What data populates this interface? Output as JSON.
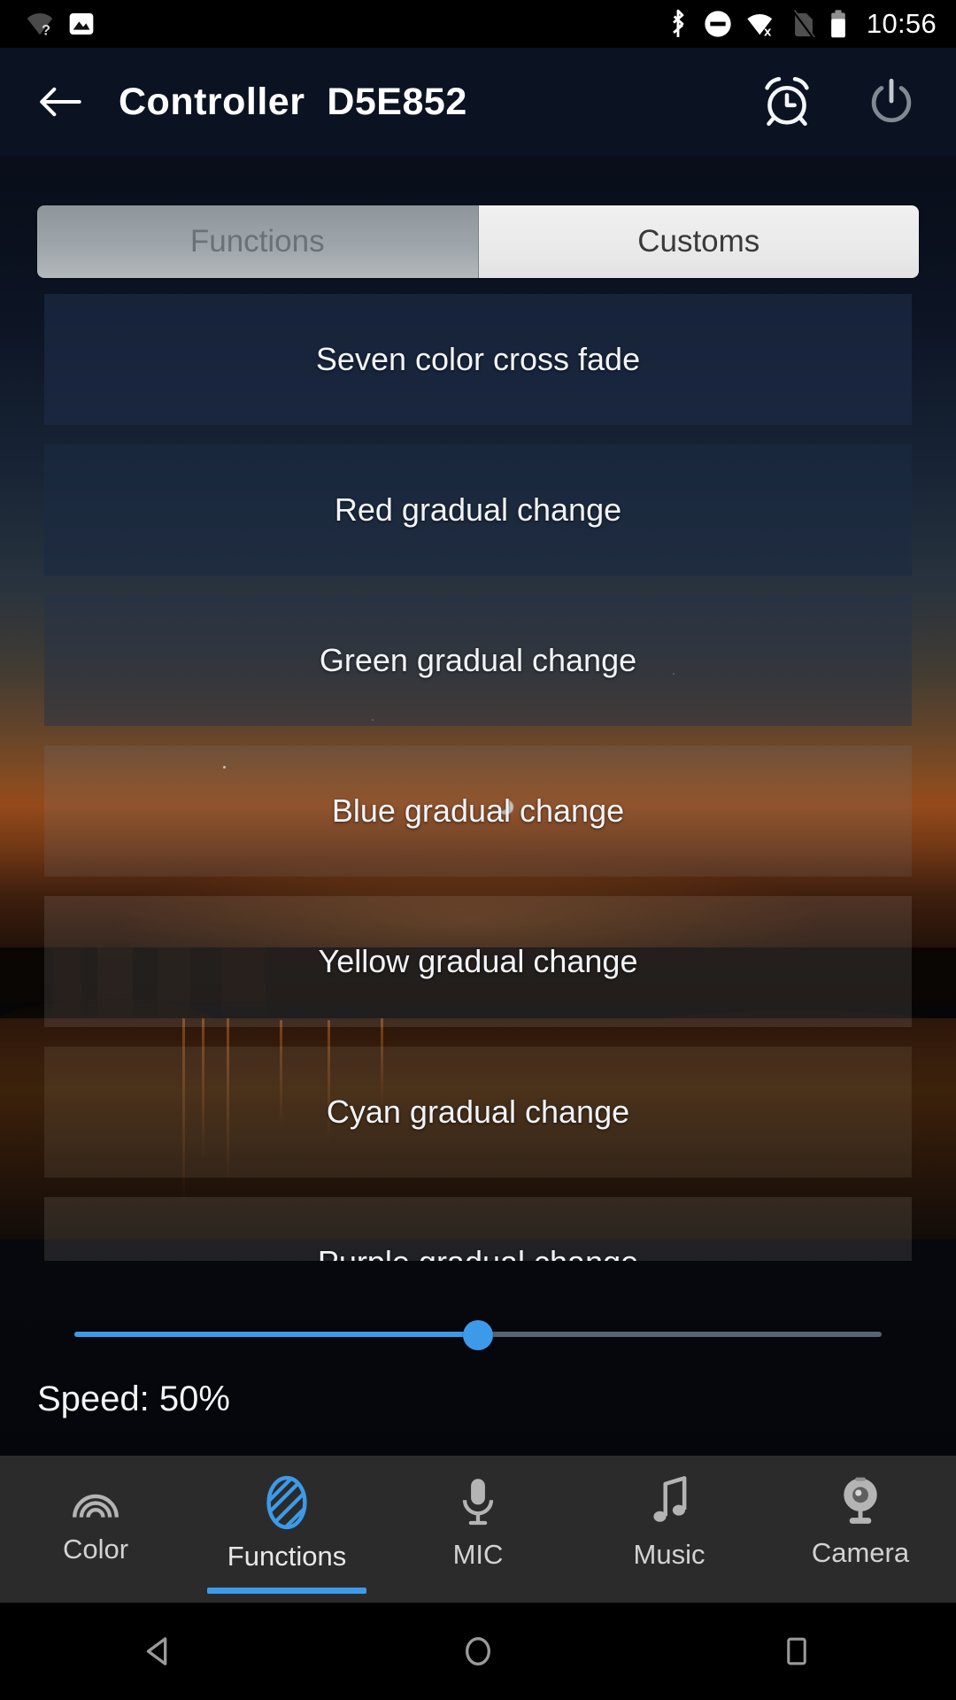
{
  "statusbar": {
    "time": "10:56",
    "left_icons": [
      "wifi-unknown-icon",
      "photo-icon"
    ],
    "right_icons": [
      "bluetooth-icon",
      "do-not-disturb-icon",
      "wifi-off-icon",
      "sim-off-icon",
      "battery-icon"
    ]
  },
  "appbar": {
    "back_icon": "back-arrow-icon",
    "title": "Controller  D5E852",
    "alarm_icon": "alarm-clock-icon",
    "power_icon": "power-icon"
  },
  "tabs": {
    "items": [
      {
        "label": "Functions",
        "selected": true
      },
      {
        "label": "Customs",
        "selected": false
      }
    ]
  },
  "effects": {
    "items": [
      {
        "label": "Seven color cross fade"
      },
      {
        "label": "Red gradual change"
      },
      {
        "label": "Green gradual change"
      },
      {
        "label": "Blue gradual change"
      },
      {
        "label": "Yellow gradual change"
      },
      {
        "label": "Cyan gradual change"
      },
      {
        "label": "Purple gradual change"
      }
    ]
  },
  "speed": {
    "label": "Speed: 50%",
    "value": 50,
    "min": 0,
    "max": 100,
    "fill_color": "#3d9ae8"
  },
  "bottomnav": {
    "items": [
      {
        "label": "Color",
        "icon": "rainbow-icon",
        "active": false
      },
      {
        "label": "Functions",
        "icon": "striped-oval-icon",
        "active": true
      },
      {
        "label": "MIC",
        "icon": "microphone-icon",
        "active": false
      },
      {
        "label": "Music",
        "icon": "music-note-icon",
        "active": false
      },
      {
        "label": "Camera",
        "icon": "webcam-icon",
        "active": false
      }
    ],
    "accent_color": "#3d9ae8"
  },
  "androidnav": {
    "items": [
      "back-triangle-icon",
      "home-circle-icon",
      "recents-square-icon"
    ]
  }
}
